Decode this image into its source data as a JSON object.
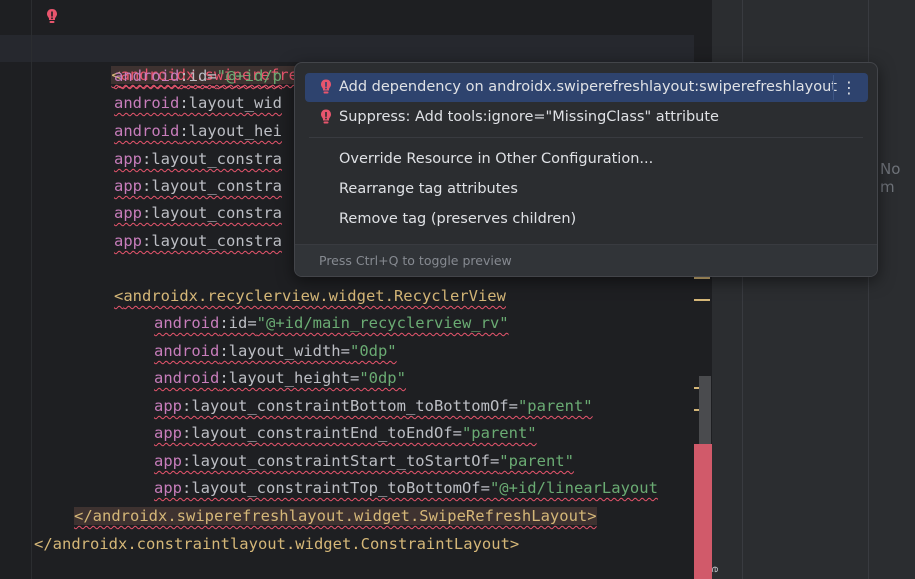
{
  "editor": {
    "lines": {
      "l1": {
        "open": "<",
        "tag": "androidx.swiperefreshlayout.widget.SwipeRefreshLayout"
      },
      "l2": {
        "ns": "android",
        "attr": ":id=",
        "val": "\"@+id/p"
      },
      "l3": {
        "ns": "android",
        "attr": ":layout_wid"
      },
      "l4": {
        "ns": "android",
        "attr": ":layout_hei"
      },
      "l5": {
        "ns": "app",
        "attr": ":layout_constra"
      },
      "l6": {
        "ns": "app",
        "attr": ":layout_constra"
      },
      "l7": {
        "ns": "app",
        "attr": ":layout_constra"
      },
      "l8": {
        "ns": "app",
        "attr": ":layout_constra"
      },
      "l9": {
        "open": "<",
        "tag": "androidx.recyclerview.widget.RecyclerView"
      },
      "l10": {
        "ns": "android",
        "attr": ":id=",
        "val": "\"@+id/main_recyclerview_rv\""
      },
      "l11": {
        "ns": "android",
        "attr": ":layout_width=",
        "val": "\"0dp\""
      },
      "l12": {
        "ns": "android",
        "attr": ":layout_height=",
        "val": "\"0dp\""
      },
      "l13": {
        "ns": "app",
        "attr": ":layout_constraintBottom_toBottomOf=",
        "val": "\"parent\""
      },
      "l14": {
        "ns": "app",
        "attr": ":layout_constraintEnd_toEndOf=",
        "val": "\"parent\""
      },
      "l15": {
        "ns": "app",
        "attr": ":layout_constraintStart_toStartOf=",
        "val": "\"parent\""
      },
      "l16": {
        "ns": "app",
        "attr": ":layout_constraintTop_toBottomOf=",
        "val": "\"@+id/linearLayout"
      },
      "l17": {
        "text": "</androidx.swiperefreshlayout.widget.SwipeRefreshLayout>"
      },
      "l18": {
        "text": "</androidx.constraintlayout.widget.ConstraintLayout>"
      }
    },
    "gutter_icon": "error-bulb-icon"
  },
  "popup": {
    "items": [
      {
        "label": "Add dependency on androidx.swiperefreshlayout:swiperefreshlayout",
        "icon": "error-bulb-icon",
        "selected": true
      },
      {
        "label": "Suppress: Add tools:ignore=\"MissingClass\" attribute",
        "icon": "error-bulb-icon"
      },
      {
        "label": "Override Resource in Other Configuration..."
      },
      {
        "label": "Rearrange tag attributes"
      },
      {
        "label": "Remove tag (preserves children)"
      }
    ],
    "more_icon": "⋮",
    "footer": "Press Ctrl+Q to toggle preview"
  },
  "right_panel": {
    "no_preview_text": "No m",
    "vertical_label": "e"
  },
  "colors": {
    "error": "#e8556d",
    "selected": "#2e436e",
    "tag": "#d5b778",
    "string": "#6aab73",
    "namespace": "#c77dbb"
  }
}
